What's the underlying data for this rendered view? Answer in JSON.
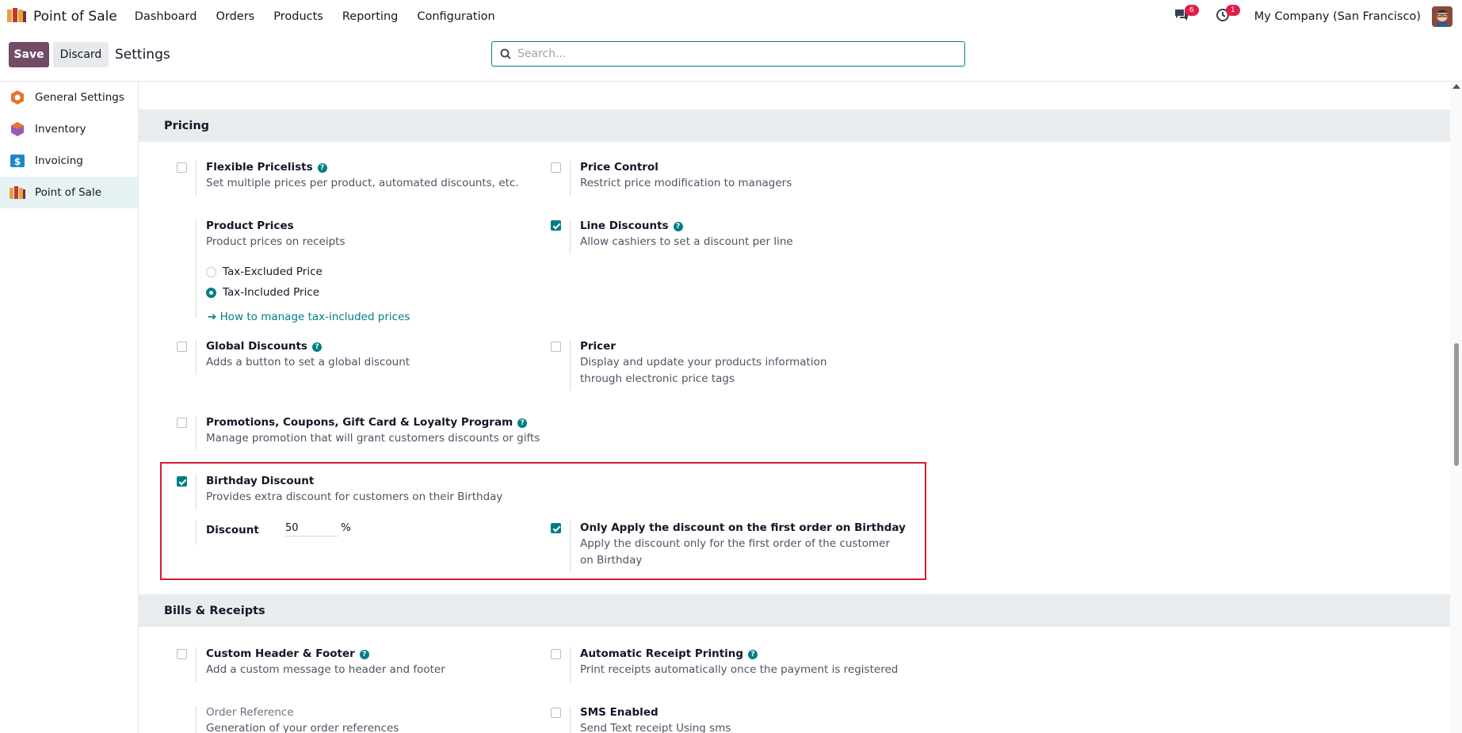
{
  "navbar": {
    "app_name": "Point of Sale",
    "menu": [
      "Dashboard",
      "Orders",
      "Products",
      "Reporting",
      "Configuration"
    ],
    "messages_count": "6",
    "activities_count": "1",
    "company": "My Company (San Francisco)"
  },
  "control": {
    "save_label": "Save",
    "discard_label": "Discard",
    "title": "Settings",
    "search_placeholder": "Search..."
  },
  "sidebar": {
    "items": [
      {
        "label": "General Settings"
      },
      {
        "label": "Inventory"
      },
      {
        "label": "Invoicing"
      },
      {
        "label": "Point of Sale"
      }
    ]
  },
  "pricing": {
    "header": "Pricing",
    "flexible_pricelists": {
      "title": "Flexible Pricelists",
      "desc": "Set multiple prices per product, automated discounts, etc.",
      "checked": false
    },
    "price_control": {
      "title": "Price Control",
      "desc": "Restrict price modification to managers",
      "checked": false
    },
    "product_prices": {
      "title": "Product Prices",
      "desc": "Product prices on receipts",
      "option_excluded": "Tax-Excluded Price",
      "option_included": "Tax-Included Price",
      "selected": "Tax-Included Price",
      "link": "➔ How to manage tax-included prices"
    },
    "line_discounts": {
      "title": "Line Discounts",
      "desc": "Allow cashiers to set a discount per line",
      "checked": true
    },
    "global_discounts": {
      "title": "Global Discounts",
      "desc": "Adds a button to set a global discount",
      "checked": false
    },
    "pricer": {
      "title": "Pricer",
      "desc": "Display and update your products information through electronic price tags",
      "checked": false
    },
    "promotions": {
      "title": "Promotions, Coupons, Gift Card & Loyalty Program",
      "desc": "Manage promotion that will grant customers discounts or gifts",
      "checked": false
    },
    "birthday": {
      "title": "Birthday Discount",
      "desc": "Provides extra discount for customers on their Birthday",
      "checked": true,
      "discount_label": "Discount",
      "discount_value": "50",
      "discount_unit": "%",
      "first_order_title": "Only Apply the discount on the first order on Birthday",
      "first_order_desc": "Apply the discount only for the first order of the customer on Birthday",
      "first_order_checked": true
    }
  },
  "bills": {
    "header": "Bills & Receipts",
    "custom_header": {
      "title": "Custom Header & Footer",
      "desc": "Add a custom message to header and footer",
      "checked": false
    },
    "auto_print": {
      "title": "Automatic Receipt Printing",
      "desc": "Print receipts automatically once the payment is registered",
      "checked": false
    },
    "order_reference": {
      "title": "Order Reference",
      "desc": "Generation of your order references"
    },
    "sms": {
      "title": "SMS Enabled",
      "desc": "Send Text receipt Using sms",
      "checked": false
    }
  },
  "colors": {
    "primary": "#714b67",
    "accent": "#017e84",
    "highlight": "#d11f2a"
  }
}
